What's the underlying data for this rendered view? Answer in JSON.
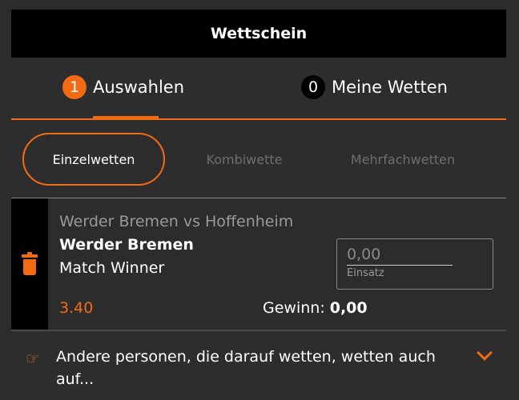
{
  "header": {
    "title": "Wettschein"
  },
  "tabs": [
    {
      "count": "1",
      "label": "Auswahlen",
      "active": true
    },
    {
      "count": "0",
      "label": "Meine Wetten",
      "active": false
    }
  ],
  "bet_types": [
    {
      "label": "Einzelwetten",
      "selected": true
    },
    {
      "label": "Kombiwette",
      "selected": false
    },
    {
      "label": "Mehrfachwetten",
      "selected": false
    }
  ],
  "selection": {
    "event": "Werder Bremen vs Hoffenheim",
    "team": "Werder Bremen",
    "market": "Match Winner",
    "odds": "3.40",
    "stake_value": "0,00",
    "stake_label": "Einsatz",
    "win_label": "Gewinn:",
    "win_value": "0,00"
  },
  "suggestion": {
    "text": "Andere personen, die darauf wetten, wetten auch auf...",
    "icon": "pointing-hand-icon"
  },
  "colors": {
    "accent": "#f26b12",
    "background": "#2d2d2d",
    "header": "#000000"
  }
}
